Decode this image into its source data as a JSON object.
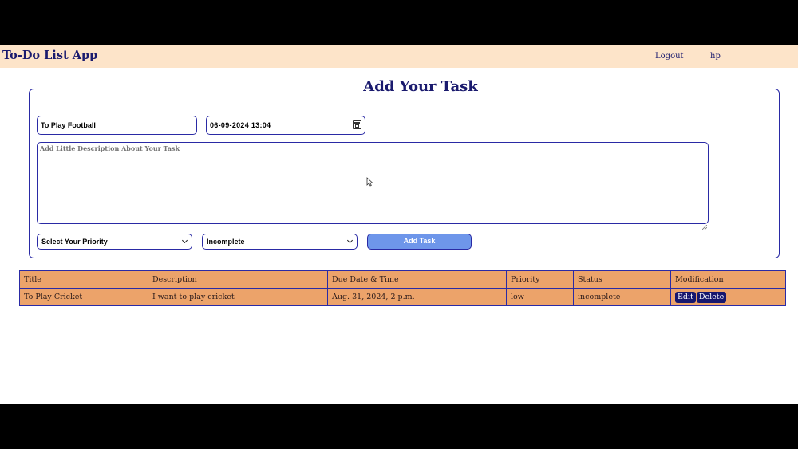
{
  "navbar": {
    "brand": "To-Do List App",
    "logout": "Logout",
    "username": "hp"
  },
  "form": {
    "legend": "Add Your Task",
    "title_value": "To Play Football",
    "date_value": "06-09-2024 13:04",
    "description_placeholder": "Add Little Description About Your Task",
    "priority_selected": "Select Your Priority",
    "status_selected": "Incomplete",
    "submit_label": "Add Task"
  },
  "table": {
    "headers": [
      "Title",
      "Description",
      "Due Date & Time",
      "Priority",
      "Status",
      "Modification"
    ],
    "rows": [
      {
        "title": "To Play Cricket",
        "description": "I want to play cricket",
        "due": "Aug. 31, 2024, 2 p.m.",
        "priority": "low",
        "status": "incomplete",
        "edit_label": "Edit",
        "delete_label": "Delete"
      }
    ]
  },
  "colors": {
    "navbar_bg": "#fde4c9",
    "accent": "#2a2aa5",
    "table_bg": "#eca36a",
    "button": "#6e96ea",
    "action_button": "#16166e"
  }
}
